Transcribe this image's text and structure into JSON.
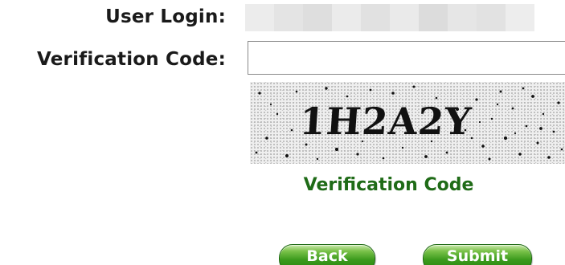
{
  "form": {
    "login_label": "User Login:",
    "code_label": "Verification Code:",
    "code_value": "",
    "captcha_text": "1H2A2Y",
    "captcha_caption": "Verification Code"
  },
  "buttons": {
    "back_label": "Back",
    "submit_label": "Submit"
  },
  "colors": {
    "caption_green": "#1f6b17",
    "button_green": "#3a9a1c",
    "label_text": "#1a1a1a"
  }
}
